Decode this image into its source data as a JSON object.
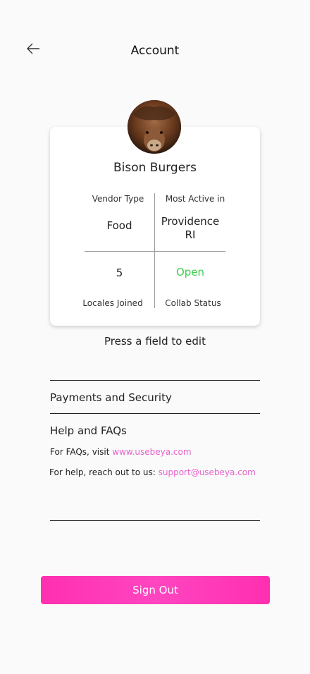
{
  "header": {
    "title": "Account",
    "back_icon": "arrow-left-icon"
  },
  "profile": {
    "name": "Bison Burgers",
    "avatar_icon": "bison-avatar"
  },
  "stats": {
    "vendor_type": {
      "label": "Vendor Type",
      "value": "Food"
    },
    "most_active": {
      "label": "Most Active in",
      "value_line1": "Providence",
      "value_line2": "RI"
    },
    "locales_joined": {
      "label": "Locales Joined",
      "value": "5"
    },
    "collab_status": {
      "label": "Collab Status",
      "value": "Open",
      "color": "#3ccf4e"
    }
  },
  "hint": "Press a field to edit",
  "menu": {
    "payments": "Payments and Security",
    "help": "Help and FAQs"
  },
  "help": {
    "faq_prefix": "For FAQs, visit",
    "faq_link": "www.usebeya.com",
    "support_prefix": "For help, reach out to us:",
    "support_link": "support@usebeya.com",
    "link_color": "#e85fce"
  },
  "signout_label": "Sign Out",
  "colors": {
    "accent": "#ff2fb0"
  }
}
